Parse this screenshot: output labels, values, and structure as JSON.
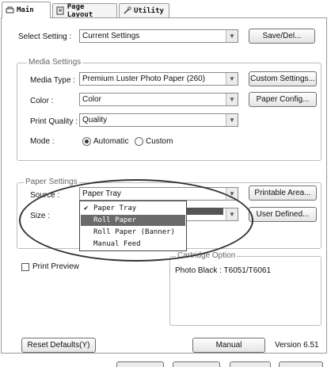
{
  "tabs": [
    {
      "label": "Main",
      "icon": "printer-icon",
      "active": true
    },
    {
      "label": "Page Layout",
      "icon": "page-layout-icon",
      "active": false
    },
    {
      "label": "Utility",
      "icon": "utility-wrench-icon",
      "active": false
    }
  ],
  "select_setting": {
    "label": "Select Setting :",
    "value": "Current Settings",
    "button": "Save/Del..."
  },
  "media_settings": {
    "title": "Media Settings",
    "media_type": {
      "label": "Media Type :",
      "value": "Premium Luster Photo Paper (260)",
      "button": "Custom Settings..."
    },
    "color": {
      "label": "Color :",
      "value": "Color",
      "button": "Paper Config..."
    },
    "print_quality": {
      "label": "Print Quality :",
      "value": "Quality"
    },
    "mode": {
      "label": "Mode :",
      "options": [
        {
          "label": "Automatic",
          "selected": true
        },
        {
          "label": "Custom",
          "selected": false
        }
      ]
    }
  },
  "paper_settings": {
    "title": "Paper Settings",
    "source": {
      "label": "Source :",
      "value": "Paper Tray",
      "button": "Printable Area..."
    },
    "size": {
      "label": "Size :",
      "button": "User Defined..."
    },
    "dropdown_options": [
      {
        "label": "Paper Tray",
        "checked": true,
        "highlighted": false
      },
      {
        "label": "Roll Paper",
        "checked": false,
        "highlighted": true
      },
      {
        "label": "Roll Paper (Banner)",
        "checked": false,
        "highlighted": false
      },
      {
        "label": "Manual Feed",
        "checked": false,
        "highlighted": false
      }
    ]
  },
  "print_preview": {
    "label": "Print Preview",
    "checked": false
  },
  "cartridge": {
    "title": "Cartridge Option",
    "value": "Photo Black : T6051/T6061"
  },
  "footer": {
    "reset": "Reset Defaults(Y)",
    "manual": "Manual",
    "version": "Version 6.51"
  },
  "colors": {
    "border": "#9a9a9a",
    "highlight": "#6a6a6a",
    "annotation": "#333333"
  }
}
